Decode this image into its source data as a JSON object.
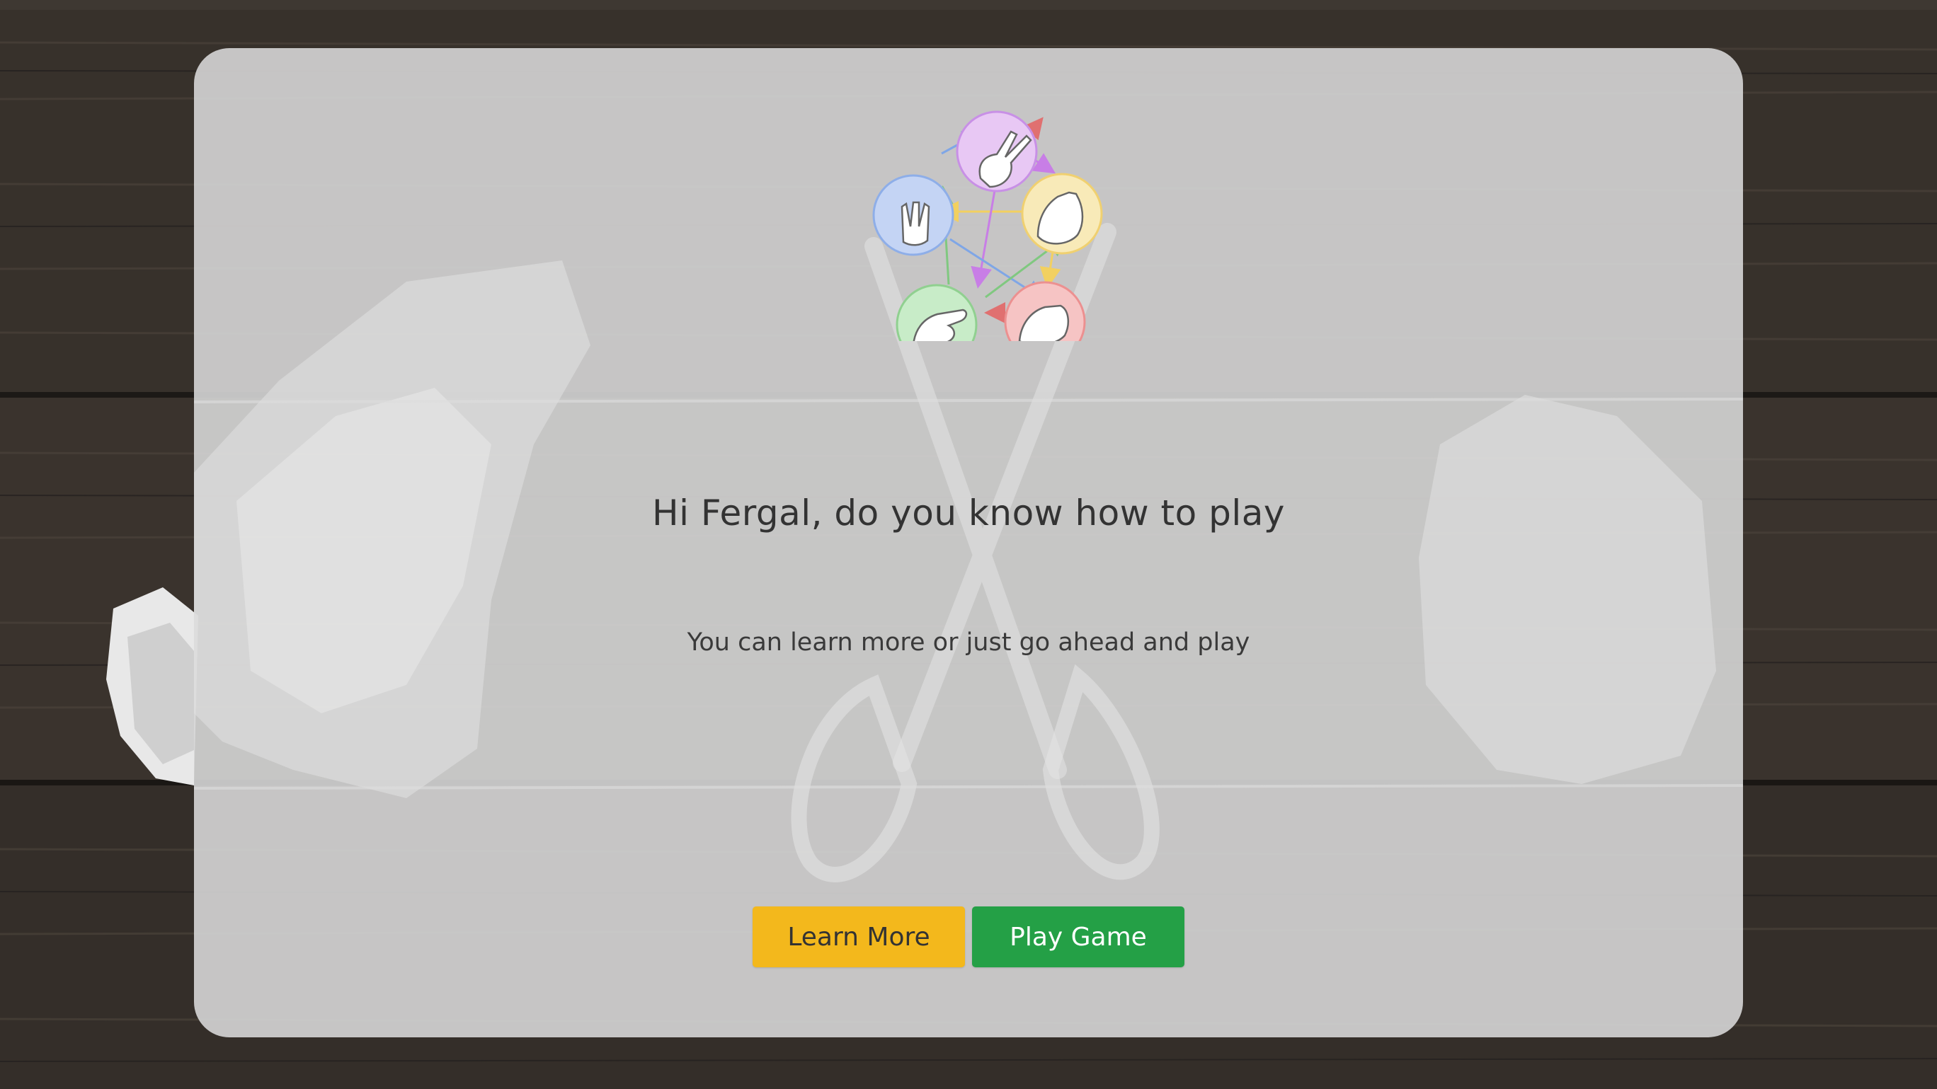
{
  "dialog": {
    "headline": "Hi Fergal, do you know how to play",
    "subline": "You can learn more or just go ahead and play"
  },
  "buttons": {
    "learn_more": "Learn More",
    "play_game": "Play Game"
  },
  "colors": {
    "learn_more_bg": "#f3b81c",
    "play_game_bg": "#24a046",
    "card_bg": "#d6d6d6",
    "scissors_circle": "#e8c8f4",
    "paper_circle": "#f8eab8",
    "rock_circle": "#f6c4c4",
    "lizard_circle": "#c8ecc8",
    "spock_circle": "#c4d4f4"
  },
  "logo": {
    "gestures": [
      "scissors-icon",
      "paper-icon",
      "rock-icon",
      "lizard-icon",
      "spock-icon"
    ]
  },
  "background": {
    "decor": [
      "wood-planks",
      "crumpled-paper",
      "scissors",
      "rock"
    ]
  }
}
